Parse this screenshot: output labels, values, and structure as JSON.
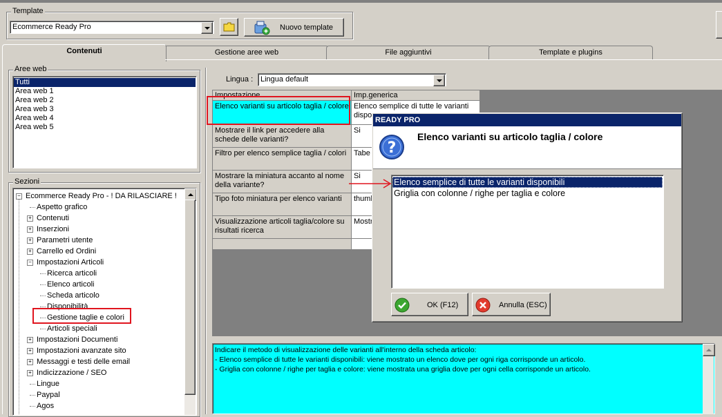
{
  "template": {
    "label": "Template",
    "selected": "Ecommerce Ready Pro",
    "new_button": "Nuovo template"
  },
  "tabs": [
    {
      "label": "Contenuti"
    },
    {
      "label": "Gestione aree web"
    },
    {
      "label": "File aggiuntivi"
    },
    {
      "label": "Template e plugins"
    }
  ],
  "aree_web": {
    "label": "Aree web",
    "items": [
      "Tutti",
      "Area web 1",
      "Area web 2",
      "Area web 3",
      "Area web 4",
      "Area web 5"
    ]
  },
  "sezioni": {
    "label": "Sezioni",
    "items": [
      {
        "label": "Ecommerce Ready Pro - ! DA RILASCIARE !",
        "level": 0,
        "expandable": true
      },
      {
        "label": "Aspetto grafico",
        "level": 1,
        "expandable": false
      },
      {
        "label": "Contenuti",
        "level": 1,
        "expandable": true
      },
      {
        "label": "Inserzioni",
        "level": 1,
        "expandable": true
      },
      {
        "label": "Parametri utente",
        "level": 1,
        "expandable": true
      },
      {
        "label": "Carrello ed Ordini",
        "level": 1,
        "expandable": true
      },
      {
        "label": "Impostazioni Articoli",
        "level": 1,
        "expandable": true
      },
      {
        "label": "Ricerca articoli",
        "level": 2,
        "expandable": false
      },
      {
        "label": "Elenco articoli",
        "level": 2,
        "expandable": false
      },
      {
        "label": "Scheda articolo",
        "level": 2,
        "expandable": false
      },
      {
        "label": "Disponibilità",
        "level": 2,
        "expandable": false
      },
      {
        "label": "Gestione taglie e colori",
        "level": 2,
        "expandable": false
      },
      {
        "label": "Articoli speciali",
        "level": 2,
        "expandable": false
      },
      {
        "label": "Impostazioni Documenti",
        "level": 1,
        "expandable": true
      },
      {
        "label": "Impostazioni avanzate sito",
        "level": 1,
        "expandable": true
      },
      {
        "label": "Messaggi e testi delle email",
        "level": 1,
        "expandable": true
      },
      {
        "label": "Indicizzazione / SEO",
        "level": 1,
        "expandable": true
      },
      {
        "label": "Lingue",
        "level": 1,
        "expandable": false
      },
      {
        "label": "Paypal",
        "level": 1,
        "expandable": false
      },
      {
        "label": "Agos",
        "level": 1,
        "expandable": false
      }
    ]
  },
  "lingua": {
    "label": "Lingua :",
    "selected": "Lingua default"
  },
  "grid": {
    "headers": [
      "Impostazione",
      "Imp.generica"
    ],
    "rows": [
      {
        "setting": "Elenco varianti su articolo taglia / colore",
        "value": "Elenco semplice di tutte le varianti dispo"
      },
      {
        "setting": "Mostrare il link per accedere alla schede delle varianti?",
        "value": "Si"
      },
      {
        "setting": "Filtro per elenco semplice taglia / colori",
        "value": "Tabe"
      },
      {
        "setting": "Mostrare la miniatura accanto al nome della variante?",
        "value": "Si"
      },
      {
        "setting": "Tipo foto miniatura per elenco varianti",
        "value": "thumb"
      },
      {
        "setting": "Visualizzazione articoli taglia/colore su risultati ricerca",
        "value": "Mostr"
      }
    ]
  },
  "description": {
    "lines": [
      "Indicare il metodo di visualizzazione delle varianti all'interno della scheda articolo:",
      "- Elenco semplice di tutte le varianti disponibili: viene mostrato un elenco dove per ogni riga corrisponde un articolo.",
      "- Griglia con colonne / righe per taglia e colore: viene mostrata una griglia dove per ogni cella corrisponde un articolo."
    ]
  },
  "dialog": {
    "title": "READY PRO",
    "question": "Elenco varianti su articolo taglia / colore",
    "options": [
      "Elenco semplice di tutte le varianti disponibili",
      "Griglia con colonne / righe per taglia e colore"
    ],
    "ok_label": "OK (F12)",
    "cancel_label": "Annulla (ESC)"
  },
  "colors": {
    "cyan": "#00ffff",
    "selection": "#0a246a",
    "highlight_red": "#e0141e",
    "title_bar": "#0a246a"
  }
}
